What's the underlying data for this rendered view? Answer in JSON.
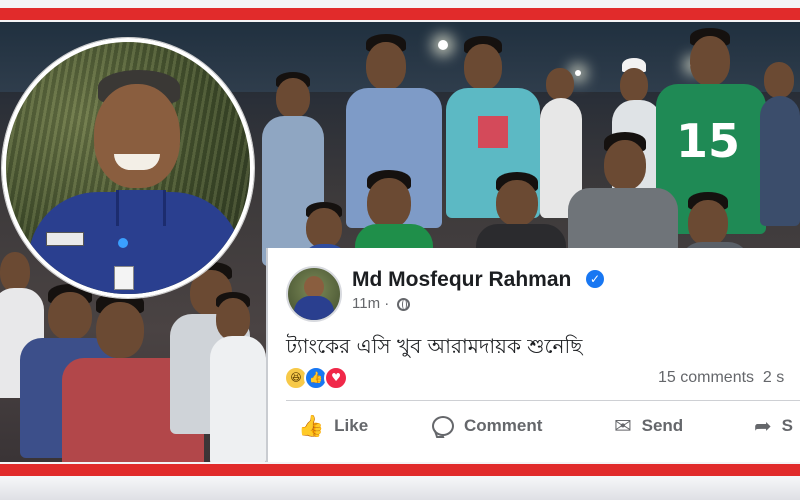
{
  "post": {
    "author": "Md Mosfequr Rahman",
    "verified_icon": "verified-badge-icon",
    "time": "11m",
    "separator": "·",
    "privacy_icon": "globe-icon",
    "text": "ট্যাংকের এসি খুব আরামদায়ক শুনেছি",
    "reactions": [
      "haha-reaction-icon",
      "like-reaction-icon",
      "love-reaction-icon"
    ],
    "counts_text": "15 comments  2 s",
    "actions": {
      "like": "Like",
      "comment": "Comment",
      "send": "Send",
      "share": "S"
    }
  },
  "jersey_number": "15",
  "colors": {
    "frame_red": "#e12b2b",
    "facebook_blue": "#1877f2",
    "love_red": "#f02849",
    "text_dark": "#1c1e21",
    "text_muted": "#65676b",
    "police_uniform": "#2a3f8f"
  }
}
